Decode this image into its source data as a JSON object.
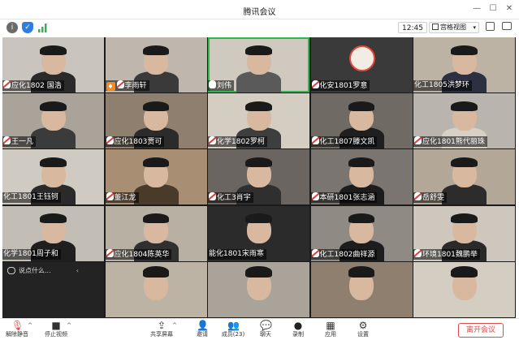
{
  "window": {
    "title": "腾讯会议",
    "minimize_glyph": "—",
    "maximize_glyph": "☐",
    "close_glyph": "✕"
  },
  "toolbar": {
    "info_icon": "info-icon",
    "shield_icon": "shield-icon",
    "signal_icon": "signal-icon",
    "clock": "12:45",
    "view_mode": "宫格视图",
    "fullscreen_icon": "fullscreen-icon",
    "popout_icon": "popout-icon"
  },
  "participants": [
    {
      "name": "应化1802 国浩",
      "mic": "muted"
    },
    {
      "name": "李雨轩",
      "mic": "host"
    },
    {
      "name": "刘伟",
      "mic": "on",
      "active": true
    },
    {
      "name": "化安1801罗意",
      "mic": "muted"
    },
    {
      "name": "化工1805洪梦环",
      "mic": "none"
    },
    {
      "name": "王一凡",
      "mic": "muted"
    },
    {
      "name": "应化1803贾可",
      "mic": "muted"
    },
    {
      "name": "化学1802罗柯",
      "mic": "muted"
    },
    {
      "name": "化工1807滕文凯",
      "mic": "muted"
    },
    {
      "name": "应化1801熊代丽珠",
      "mic": "muted"
    },
    {
      "name": "化工1801王钰钶",
      "mic": "none"
    },
    {
      "name": "董江龙",
      "mic": "muted"
    },
    {
      "name": "化工3肖宇",
      "mic": "muted"
    },
    {
      "name": "本研1801张志涵",
      "mic": "muted"
    },
    {
      "name": "岳舒雯",
      "mic": "muted"
    },
    {
      "name": "化学1801周子和",
      "mic": "none"
    },
    {
      "name": "应化1804陈英华",
      "mic": "muted"
    },
    {
      "name": "能化1801宋雨寒",
      "mic": "none"
    },
    {
      "name": "化工1802曲祥源",
      "mic": "muted"
    },
    {
      "name": "环境1801魏鹏举",
      "mic": "muted"
    }
  ],
  "chat_hint": "说点什么...",
  "chat_chevron": "‹",
  "controls": [
    {
      "label": "解除静音",
      "icon": "mic-muted-icon",
      "glyph": "🎙",
      "caret": true
    },
    {
      "label": "停止视频",
      "icon": "video-icon",
      "glyph": "■",
      "caret": true
    },
    {
      "label": "共享屏幕",
      "icon": "share-screen-icon",
      "glyph": "⇪",
      "caret": true
    },
    {
      "label": "邀请",
      "icon": "invite-icon",
      "glyph": "👤"
    },
    {
      "label": "成员(23)",
      "icon": "members-icon",
      "glyph": "👥"
    },
    {
      "label": "聊天",
      "icon": "chat-icon",
      "glyph": "💬"
    },
    {
      "label": "录制",
      "icon": "record-icon",
      "glyph": "●"
    },
    {
      "label": "应用",
      "icon": "apps-icon",
      "glyph": "▦"
    },
    {
      "label": "设置",
      "icon": "settings-icon",
      "glyph": "⚙"
    }
  ],
  "end_meeting": "离开会议",
  "colors": {
    "accent_green": "#2db84d",
    "end_red": "#e04a4a",
    "grid_bg": "#1b1b1b"
  }
}
